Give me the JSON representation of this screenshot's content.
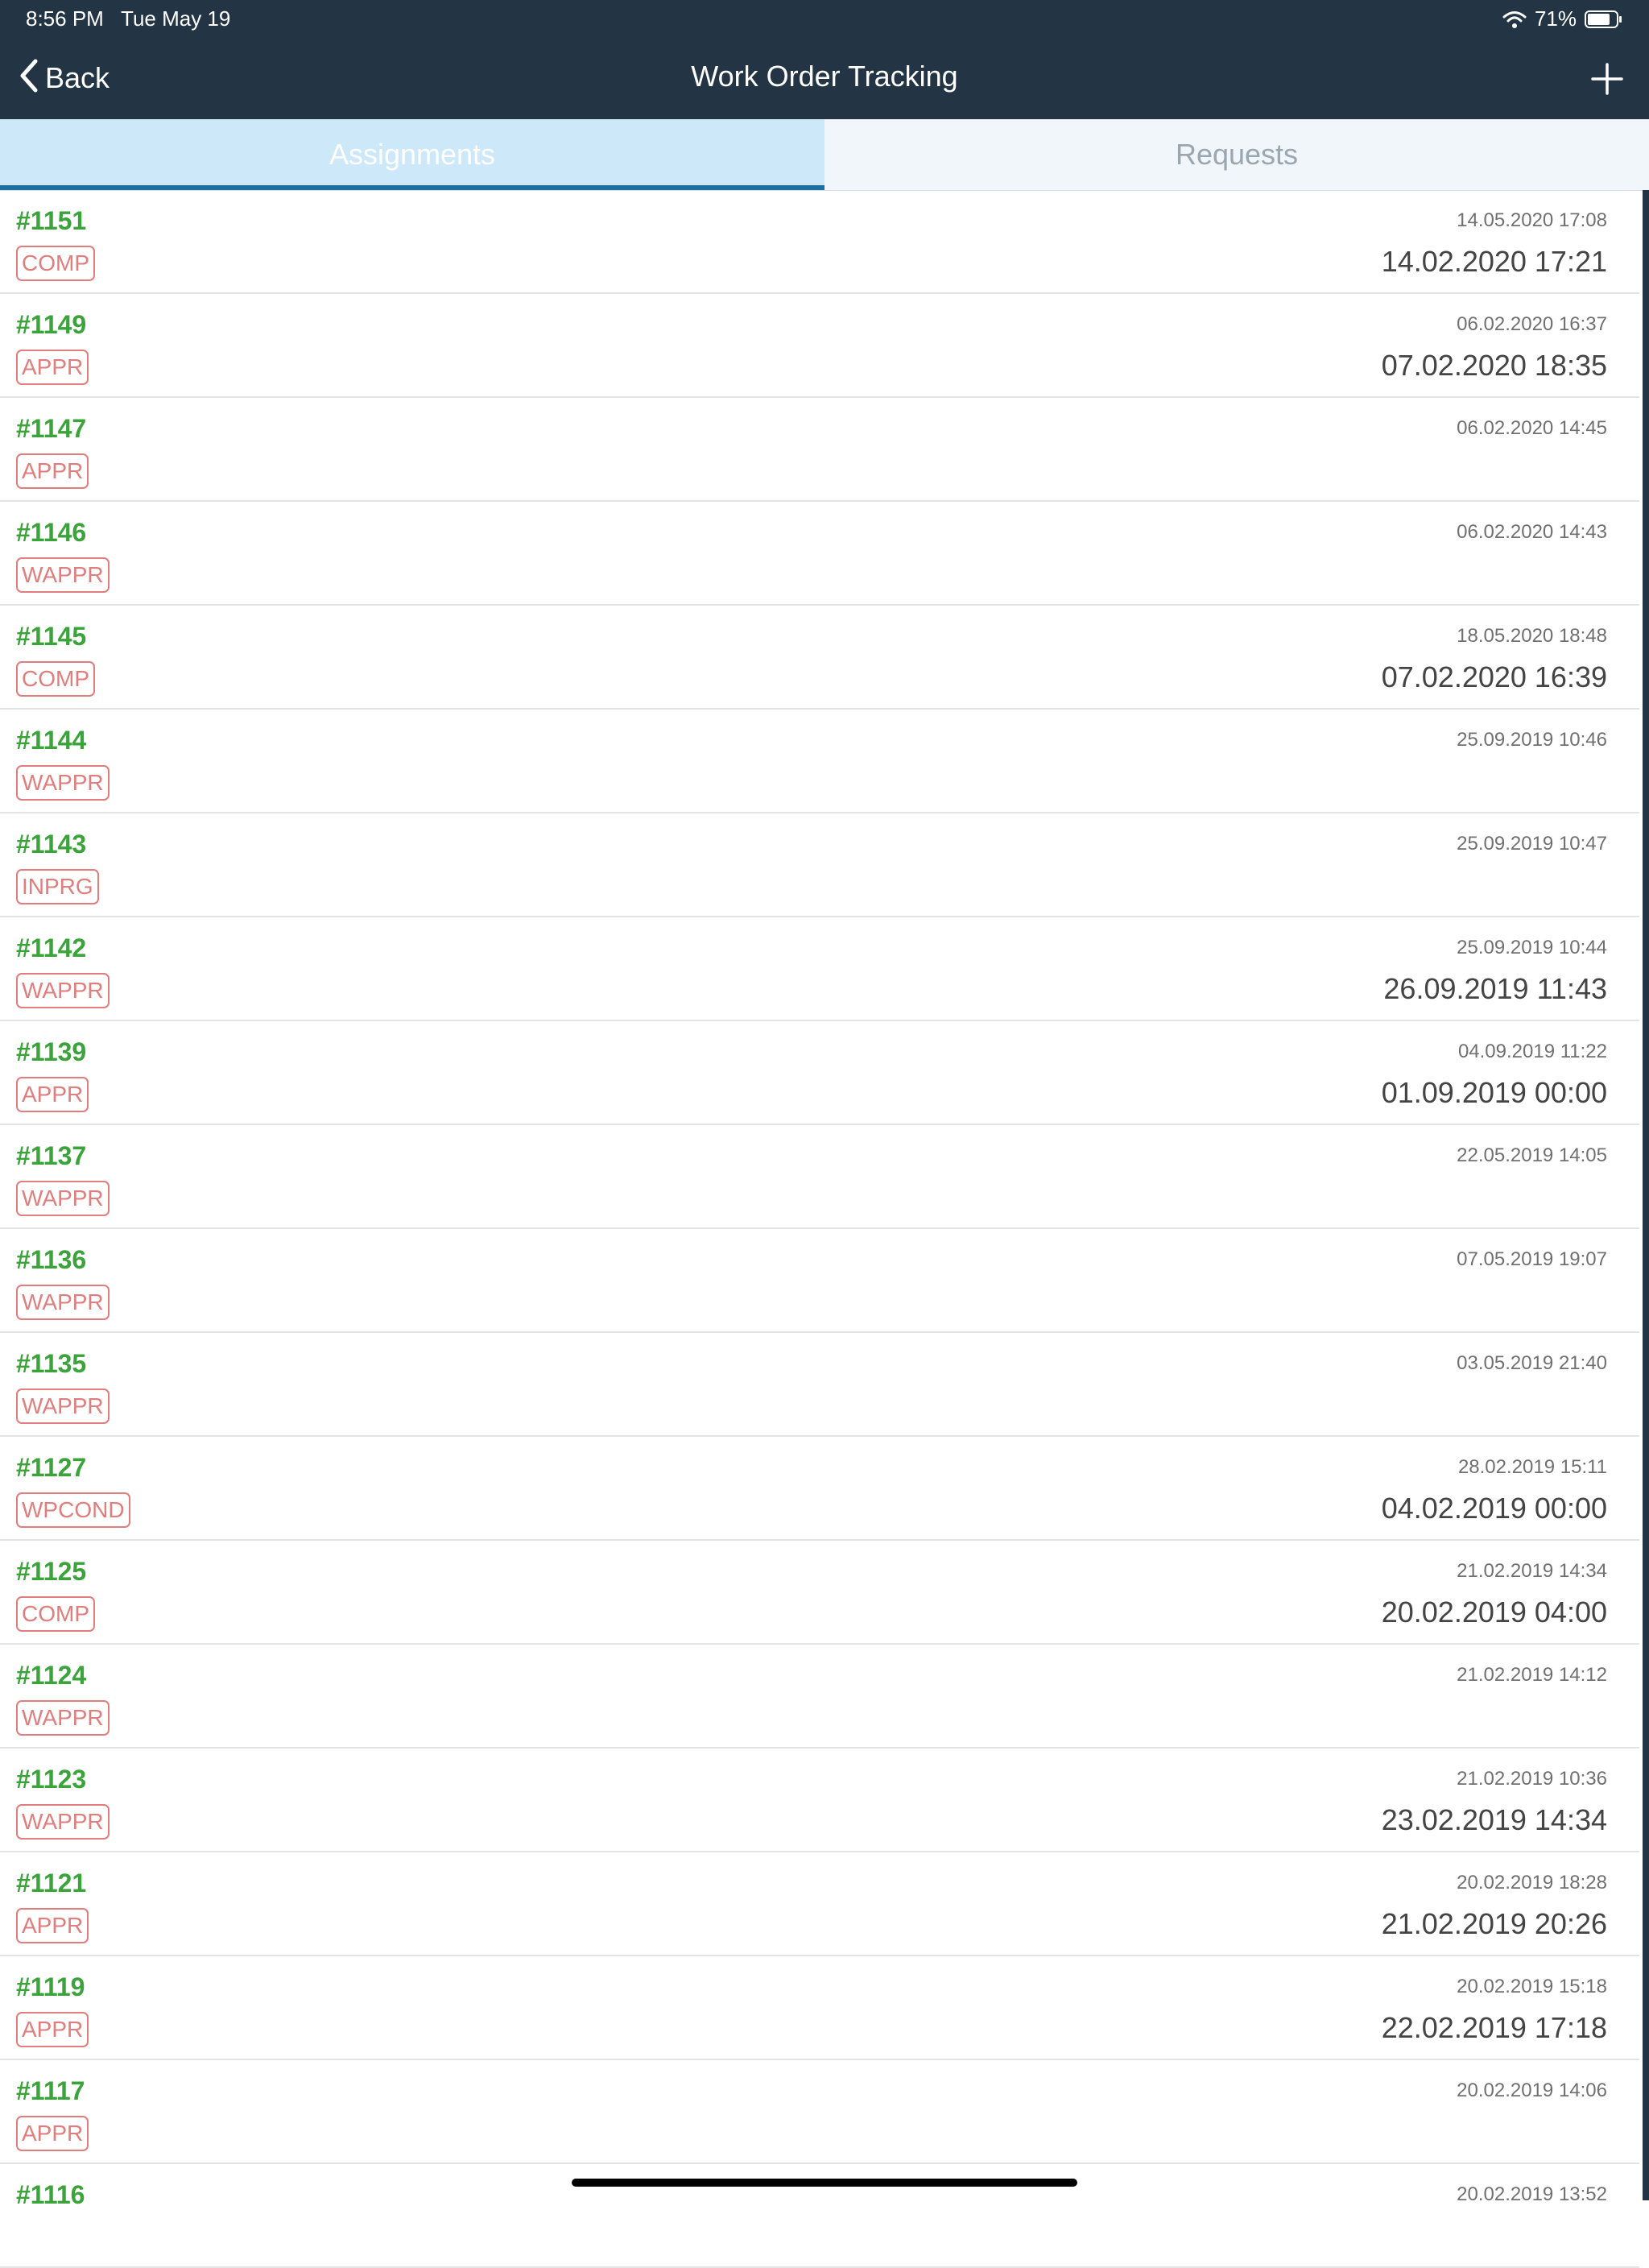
{
  "status_bar": {
    "time": "8:56 PM",
    "date": "Tue May 19",
    "battery": "71%"
  },
  "nav": {
    "back_label": "Back",
    "title": "Work Order Tracking"
  },
  "tabs": [
    {
      "label": "Assignments",
      "active": true
    },
    {
      "label": "Requests",
      "active": false
    }
  ],
  "colors": {
    "nav_bg": "#233544",
    "wo_number": "#3aa43a",
    "status_badge": "#e07d7d",
    "tab_active_bg": "#cde8f8",
    "tab_indicator": "#1c6ea1"
  },
  "icons": {
    "back": "chevron-left-icon",
    "add": "plus-icon",
    "wifi": "wifi-icon",
    "battery": "battery-icon"
  },
  "work_orders": [
    {
      "number": "#1151",
      "status": "COMP",
      "date_small": "14.05.2020 17:08",
      "date_large": "14.02.2020 17:21"
    },
    {
      "number": "#1149",
      "status": "APPR",
      "date_small": "06.02.2020 16:37",
      "date_large": "07.02.2020 18:35"
    },
    {
      "number": "#1147",
      "status": "APPR",
      "date_small": "06.02.2020 14:45",
      "date_large": ""
    },
    {
      "number": "#1146",
      "status": "WAPPR",
      "date_small": "06.02.2020 14:43",
      "date_large": ""
    },
    {
      "number": "#1145",
      "status": "COMP",
      "date_small": "18.05.2020 18:48",
      "date_large": "07.02.2020 16:39"
    },
    {
      "number": "#1144",
      "status": "WAPPR",
      "date_small": "25.09.2019 10:46",
      "date_large": ""
    },
    {
      "number": "#1143",
      "status": "INPRG",
      "date_small": "25.09.2019 10:47",
      "date_large": ""
    },
    {
      "number": "#1142",
      "status": "WAPPR",
      "date_small": "25.09.2019 10:44",
      "date_large": "26.09.2019 11:43"
    },
    {
      "number": "#1139",
      "status": "APPR",
      "date_small": "04.09.2019 11:22",
      "date_large": "01.09.2019 00:00"
    },
    {
      "number": "#1137",
      "status": "WAPPR",
      "date_small": "22.05.2019 14:05",
      "date_large": ""
    },
    {
      "number": "#1136",
      "status": "WAPPR",
      "date_small": "07.05.2019 19:07",
      "date_large": ""
    },
    {
      "number": "#1135",
      "status": "WAPPR",
      "date_small": "03.05.2019 21:40",
      "date_large": ""
    },
    {
      "number": "#1127",
      "status": "WPCOND",
      "date_small": "28.02.2019 15:11",
      "date_large": "04.02.2019 00:00"
    },
    {
      "number": "#1125",
      "status": "COMP",
      "date_small": "21.02.2019 14:34",
      "date_large": "20.02.2019 04:00"
    },
    {
      "number": "#1124",
      "status": "WAPPR",
      "date_small": "21.02.2019 14:12",
      "date_large": ""
    },
    {
      "number": "#1123",
      "status": "WAPPR",
      "date_small": "21.02.2019 10:36",
      "date_large": "23.02.2019 14:34"
    },
    {
      "number": "#1121",
      "status": "APPR",
      "date_small": "20.02.2019 18:28",
      "date_large": "21.02.2019 20:26"
    },
    {
      "number": "#1119",
      "status": "APPR",
      "date_small": "20.02.2019 15:18",
      "date_large": "22.02.2019 17:18"
    },
    {
      "number": "#1117",
      "status": "APPR",
      "date_small": "20.02.2019 14:06",
      "date_large": ""
    },
    {
      "number": "#1116",
      "status": "",
      "date_small": "20.02.2019 13:52",
      "date_large": ""
    }
  ]
}
